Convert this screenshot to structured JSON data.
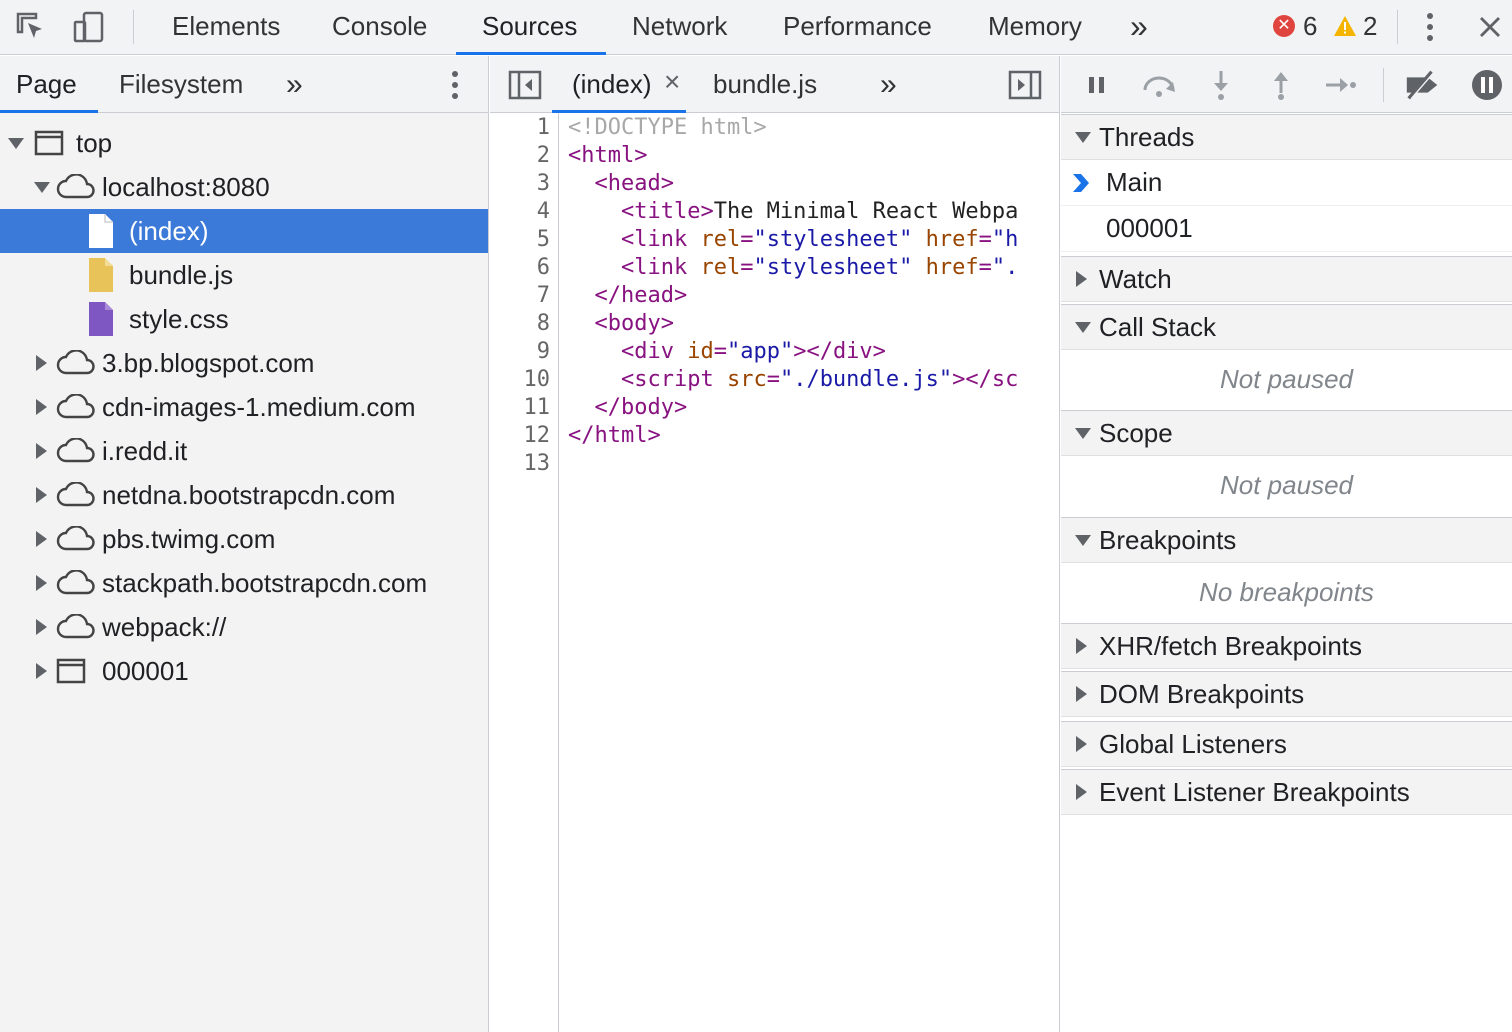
{
  "toolbar": {
    "tabs": [
      "Elements",
      "Console",
      "Sources",
      "Network",
      "Performance",
      "Memory"
    ],
    "active_tab": "Sources",
    "more_tabs": "»",
    "error_count": "6",
    "warning_count": "2"
  },
  "navigator": {
    "tabs": [
      "Page",
      "Filesystem"
    ],
    "more": "»",
    "tree": [
      {
        "label": "top",
        "icon": "frame-icon",
        "level": 0,
        "expanded": true
      },
      {
        "label": "localhost:8080",
        "icon": "cloud-icon",
        "level": 1,
        "expanded": true
      },
      {
        "label": "(index)",
        "icon": "document-icon",
        "level": 2,
        "selected": true
      },
      {
        "label": "bundle.js",
        "icon": "js-file-icon",
        "level": 2
      },
      {
        "label": "style.css",
        "icon": "css-file-icon",
        "level": 2
      },
      {
        "label": "3.bp.blogspot.com",
        "icon": "cloud-icon",
        "level": 1,
        "expanded": false
      },
      {
        "label": "cdn-images-1.medium.com",
        "icon": "cloud-icon",
        "level": 1,
        "expanded": false
      },
      {
        "label": "i.redd.it",
        "icon": "cloud-icon",
        "level": 1,
        "expanded": false
      },
      {
        "label": "netdna.bootstrapcdn.com",
        "icon": "cloud-icon",
        "level": 1,
        "expanded": false
      },
      {
        "label": "pbs.twimg.com",
        "icon": "cloud-icon",
        "level": 1,
        "expanded": false
      },
      {
        "label": "stackpath.bootstrapcdn.com",
        "icon": "cloud-icon",
        "level": 1,
        "expanded": false
      },
      {
        "label": "webpack://",
        "icon": "cloud-icon",
        "level": 1,
        "expanded": false
      },
      {
        "label": "000001",
        "icon": "frame-icon",
        "level": 1,
        "expanded": false
      }
    ]
  },
  "editor": {
    "tabs": [
      {
        "label": "(index)",
        "close": "×",
        "active": true
      },
      {
        "label": "bundle.js"
      }
    ],
    "more": "»",
    "lines": [
      [
        {
          "t": "doc",
          "v": "<!DOCTYPE html>"
        }
      ],
      [
        {
          "t": "tag",
          "v": "<html>"
        }
      ],
      [
        {
          "t": "txt",
          "v": "  "
        },
        {
          "t": "tag",
          "v": "<head>"
        }
      ],
      [
        {
          "t": "txt",
          "v": "    "
        },
        {
          "t": "tag",
          "v": "<title>"
        },
        {
          "t": "txt",
          "v": "The Minimal React Webpa"
        }
      ],
      [
        {
          "t": "txt",
          "v": "    "
        },
        {
          "t": "tag",
          "v": "<link "
        },
        {
          "t": "attr",
          "v": "rel"
        },
        {
          "t": "tag",
          "v": "="
        },
        {
          "t": "val",
          "v": "\"stylesheet\""
        },
        {
          "t": "txt",
          "v": " "
        },
        {
          "t": "attr",
          "v": "href"
        },
        {
          "t": "tag",
          "v": "="
        },
        {
          "t": "val",
          "v": "\"h"
        }
      ],
      [
        {
          "t": "txt",
          "v": "    "
        },
        {
          "t": "tag",
          "v": "<link "
        },
        {
          "t": "attr",
          "v": "rel"
        },
        {
          "t": "tag",
          "v": "="
        },
        {
          "t": "val",
          "v": "\"stylesheet\""
        },
        {
          "t": "txt",
          "v": " "
        },
        {
          "t": "attr",
          "v": "href"
        },
        {
          "t": "tag",
          "v": "="
        },
        {
          "t": "val",
          "v": "\"."
        }
      ],
      [
        {
          "t": "txt",
          "v": "  "
        },
        {
          "t": "tag",
          "v": "</head>"
        }
      ],
      [
        {
          "t": "txt",
          "v": "  "
        },
        {
          "t": "tag",
          "v": "<body>"
        }
      ],
      [
        {
          "t": "txt",
          "v": "    "
        },
        {
          "t": "tag",
          "v": "<div "
        },
        {
          "t": "attr",
          "v": "id"
        },
        {
          "t": "tag",
          "v": "="
        },
        {
          "t": "val",
          "v": "\"app\""
        },
        {
          "t": "tag",
          "v": "></div>"
        }
      ],
      [
        {
          "t": "txt",
          "v": "    "
        },
        {
          "t": "tag",
          "v": "<script "
        },
        {
          "t": "attr",
          "v": "src"
        },
        {
          "t": "tag",
          "v": "="
        },
        {
          "t": "val",
          "v": "\"./bundle.js\""
        },
        {
          "t": "tag",
          "v": "></sc"
        }
      ],
      [
        {
          "t": "txt",
          "v": "  "
        },
        {
          "t": "tag",
          "v": "</body>"
        }
      ],
      [
        {
          "t": "tag",
          "v": "</html>"
        }
      ],
      []
    ]
  },
  "debugger": {
    "sections": {
      "threads": "Threads",
      "watch": "Watch",
      "call_stack": "Call Stack",
      "scope": "Scope",
      "breakpoints": "Breakpoints",
      "xhr": "XHR/fetch Breakpoints",
      "dom": "DOM Breakpoints",
      "global": "Global Listeners",
      "event": "Event Listener Breakpoints"
    },
    "threads": [
      "Main",
      "000001"
    ],
    "call_stack_empty": "Not paused",
    "scope_empty": "Not paused",
    "breakpoints_empty": "No breakpoints"
  },
  "colors": {
    "accent": "#1a73e8",
    "selection": "#3b7ad8",
    "error": "#e0443e",
    "warning": "#f4b400"
  }
}
